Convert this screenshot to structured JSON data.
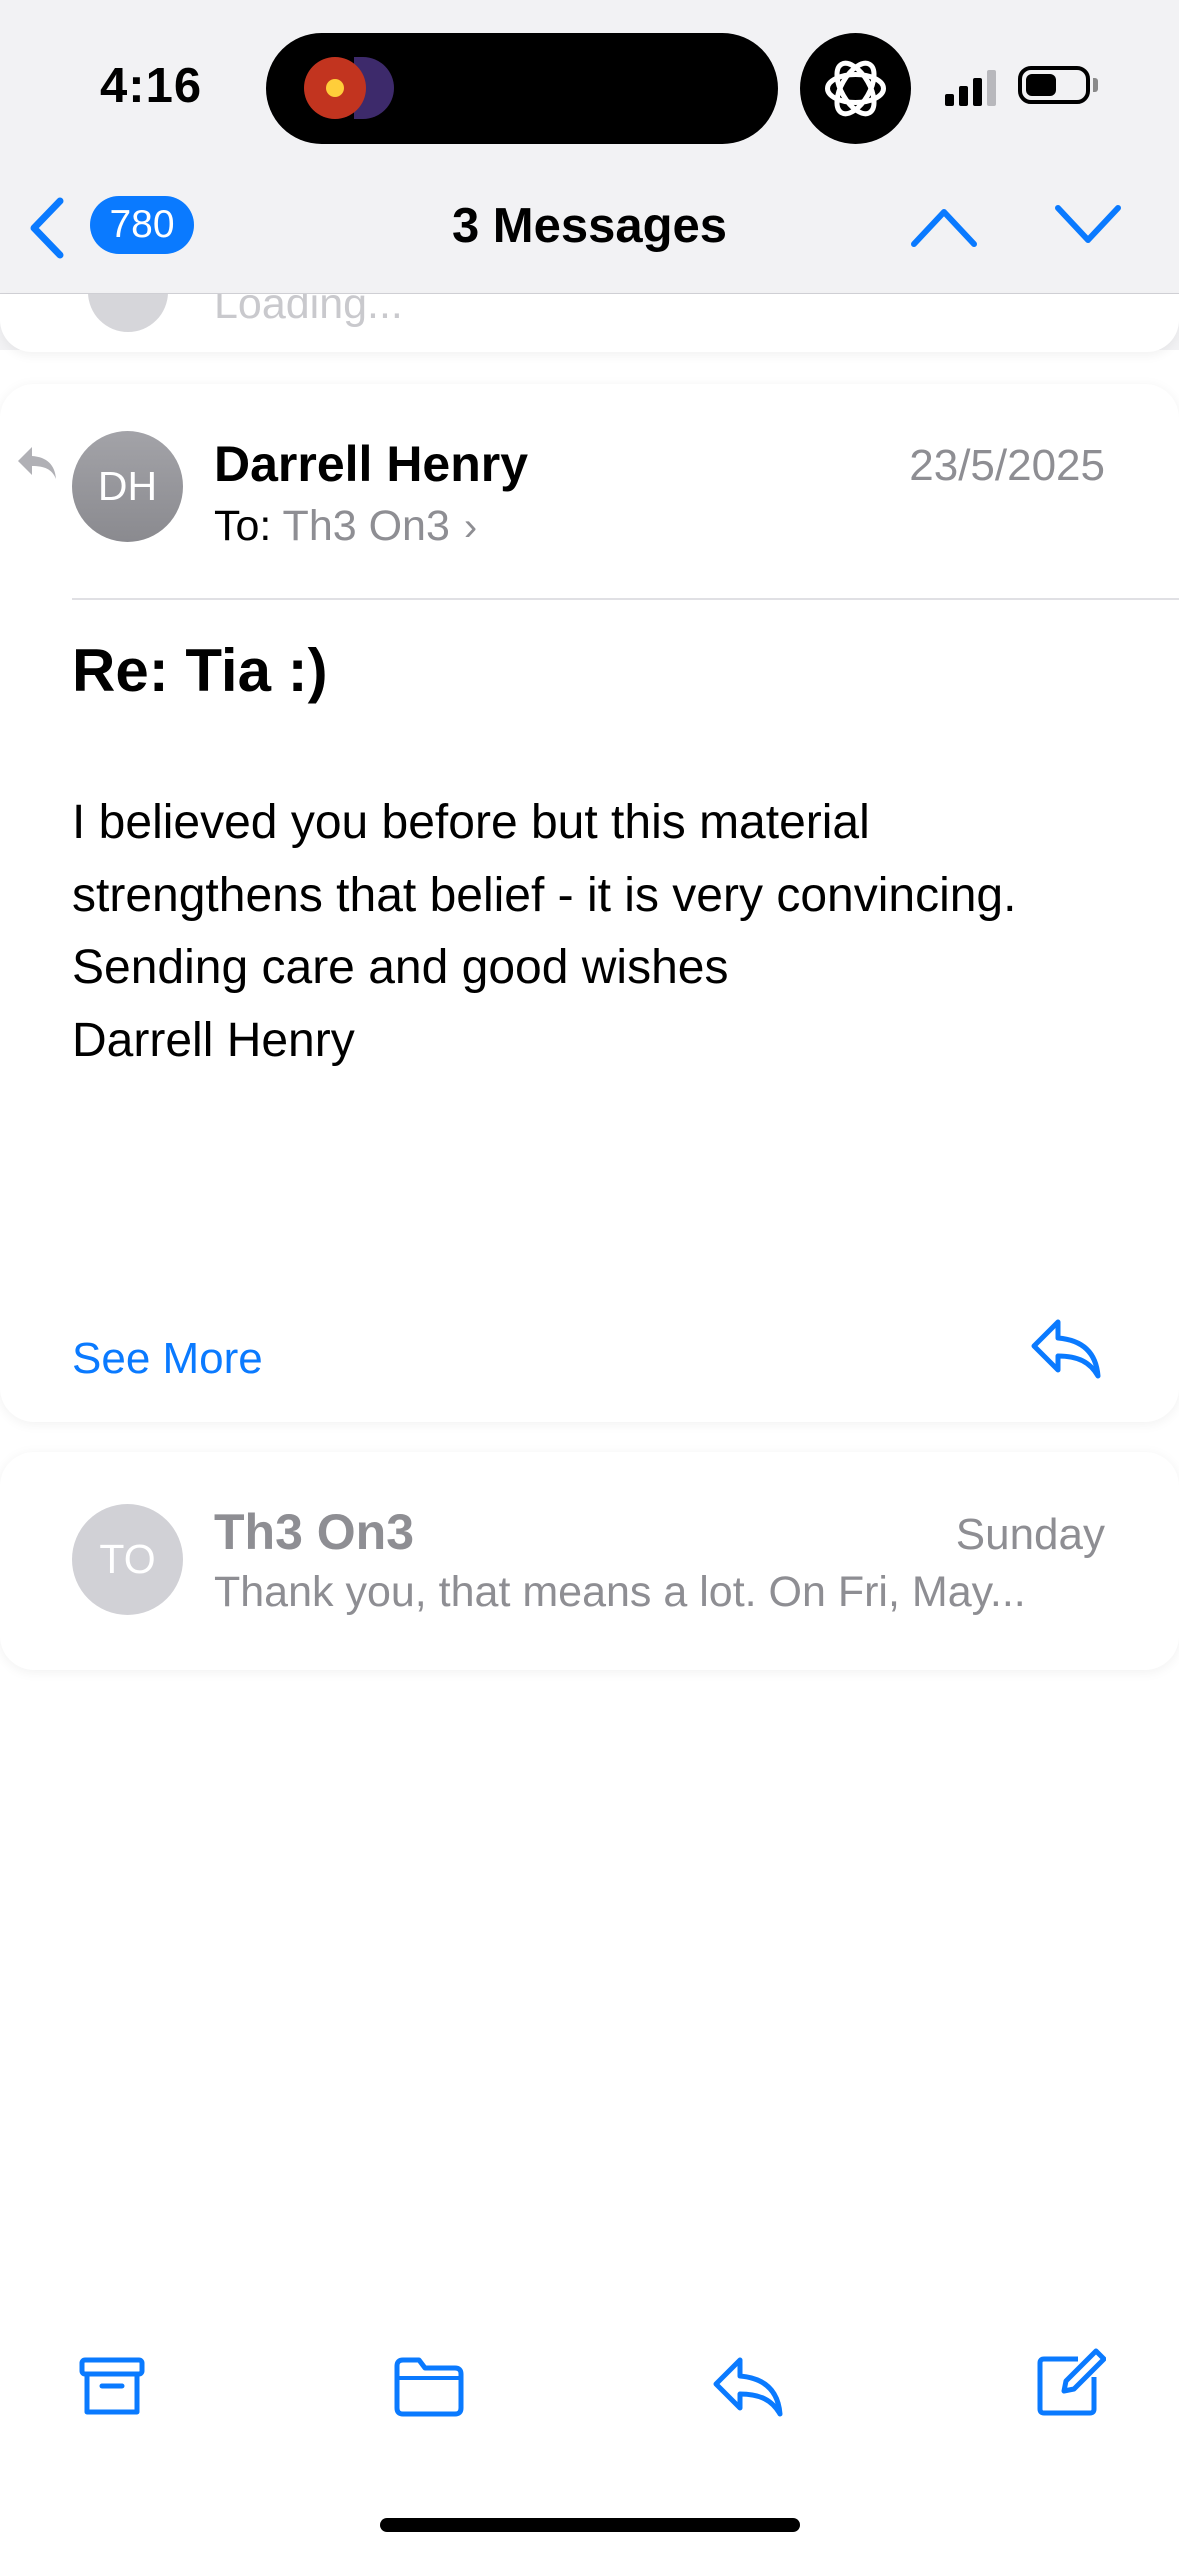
{
  "status_bar": {
    "time": "4:16"
  },
  "nav": {
    "unread_count": "780",
    "title": "3 Messages"
  },
  "previous_message": {
    "preview_text": "Loading..."
  },
  "message": {
    "avatar_initials": "DH",
    "sender": "Darrell Henry",
    "date": "23/5/2025",
    "to_label": "To:",
    "recipient": "Th3 On3",
    "subject": "Re: Tia :)",
    "body_lines": [
      "I believed you before but this material",
      "strengthens that belief - it is very convincing.",
      "Sending care and good wishes",
      "Darrell Henry"
    ],
    "see_more": "See More"
  },
  "next_message": {
    "avatar_initials": "TO",
    "sender": "Th3 On3",
    "date": "Sunday",
    "preview": "Thank you, that means a lot. On Fri, May..."
  },
  "colors": {
    "accent": "#0a7aff",
    "secondary_text": "#8e8e93"
  }
}
